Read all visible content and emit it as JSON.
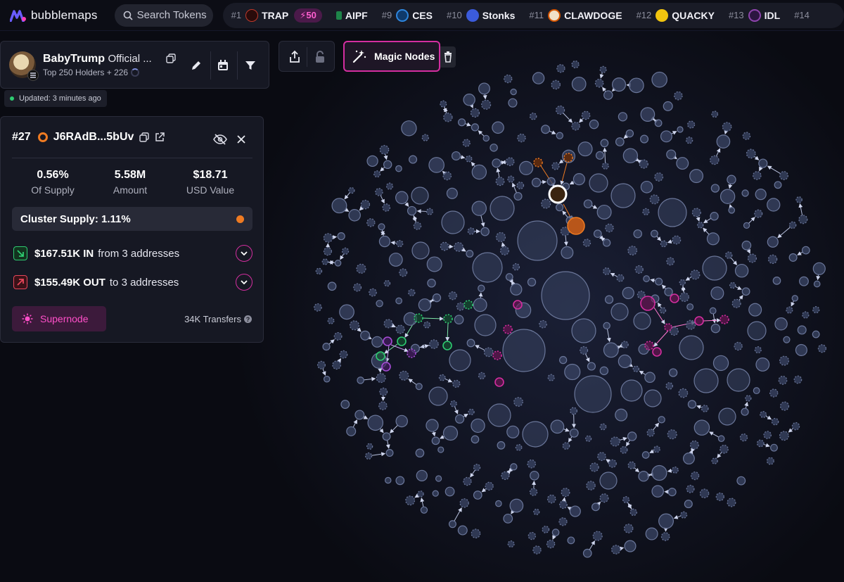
{
  "app": {
    "name": "bubblemaps"
  },
  "search": {
    "placeholder": "Search Tokens"
  },
  "trending": [
    {
      "rank": "#1",
      "symbol": "TRAP",
      "icon": "trap-icon",
      "boost": "50",
      "color": "#c0392b"
    },
    {
      "rank": "",
      "symbol": "AIPF",
      "icon": "aipf-icon",
      "color": "#1e8449"
    },
    {
      "rank": "#9",
      "symbol": "CES",
      "icon": "ces-icon",
      "color": "#2e86de"
    },
    {
      "rank": "#10",
      "symbol": "Stonks",
      "icon": "stonks-icon",
      "color": "#3b5bdb"
    },
    {
      "rank": "#11",
      "symbol": "CLAWDOGE",
      "icon": "clawdoge-icon",
      "color": "#d35400"
    },
    {
      "rank": "#12",
      "symbol": "QUACKY",
      "icon": "quacky-icon",
      "color": "#f1c40f"
    },
    {
      "rank": "#13",
      "symbol": "IDL",
      "icon": "idl-icon",
      "color": "#5b2c6f"
    },
    {
      "rank": "#14",
      "symbol": "",
      "icon": "token-icon",
      "color": "#444"
    }
  ],
  "token": {
    "name": "BabyTrump",
    "name_suffix": "Official ...",
    "holders_text": "Top 250 Holders + 226",
    "updated": "Updated: 3 minutes ago"
  },
  "toolbar": {
    "magic_nodes": "Magic Nodes"
  },
  "wallet": {
    "rank": "#27",
    "address": "J6RAdB...5bUv",
    "stats": [
      {
        "value": "0.56%",
        "label": "Of Supply"
      },
      {
        "value": "5.58M",
        "label": "Amount"
      },
      {
        "value": "$18.71",
        "label": "USD Value"
      }
    ],
    "cluster_supply": "Cluster Supply: 1.11%",
    "in_amount": "$167.51K IN",
    "in_text": "from 3 addresses",
    "out_amount": "$155.49K OUT",
    "out_text": "to 3 addresses",
    "supernode": "Supernode",
    "transfers": "34K Transfers"
  },
  "colors": {
    "bubble": "#3b4565",
    "bubble_stroke": "#6a7699",
    "highlight_orange": "#ef7b22",
    "magenta": "#d42ea0",
    "green": "#2ecc71",
    "purple": "#a64cd6"
  }
}
